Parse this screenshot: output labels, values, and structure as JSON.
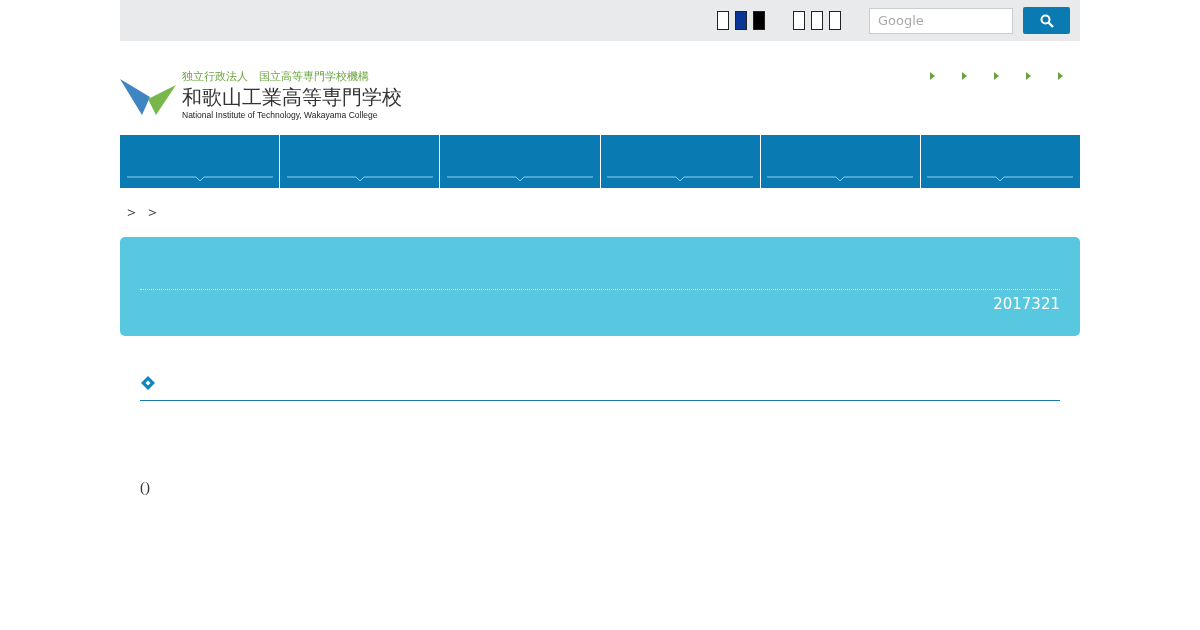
{
  "topbar": {
    "color_swatches": [
      {
        "color": "#ffffff"
      },
      {
        "color": "#0a3594"
      },
      {
        "color": "#000000"
      }
    ],
    "search": {
      "placeholder": "Google"
    }
  },
  "header": {
    "org": "独立行政法人　国立高等専門学校機構",
    "name": "和歌山工業高等専門学校",
    "name_en": "National Institute of Technology, Wakayama College"
  },
  "breadcrumb": [
    "＞",
    "＞"
  ],
  "banner": {
    "date": "2017321"
  },
  "body_text": "()"
}
